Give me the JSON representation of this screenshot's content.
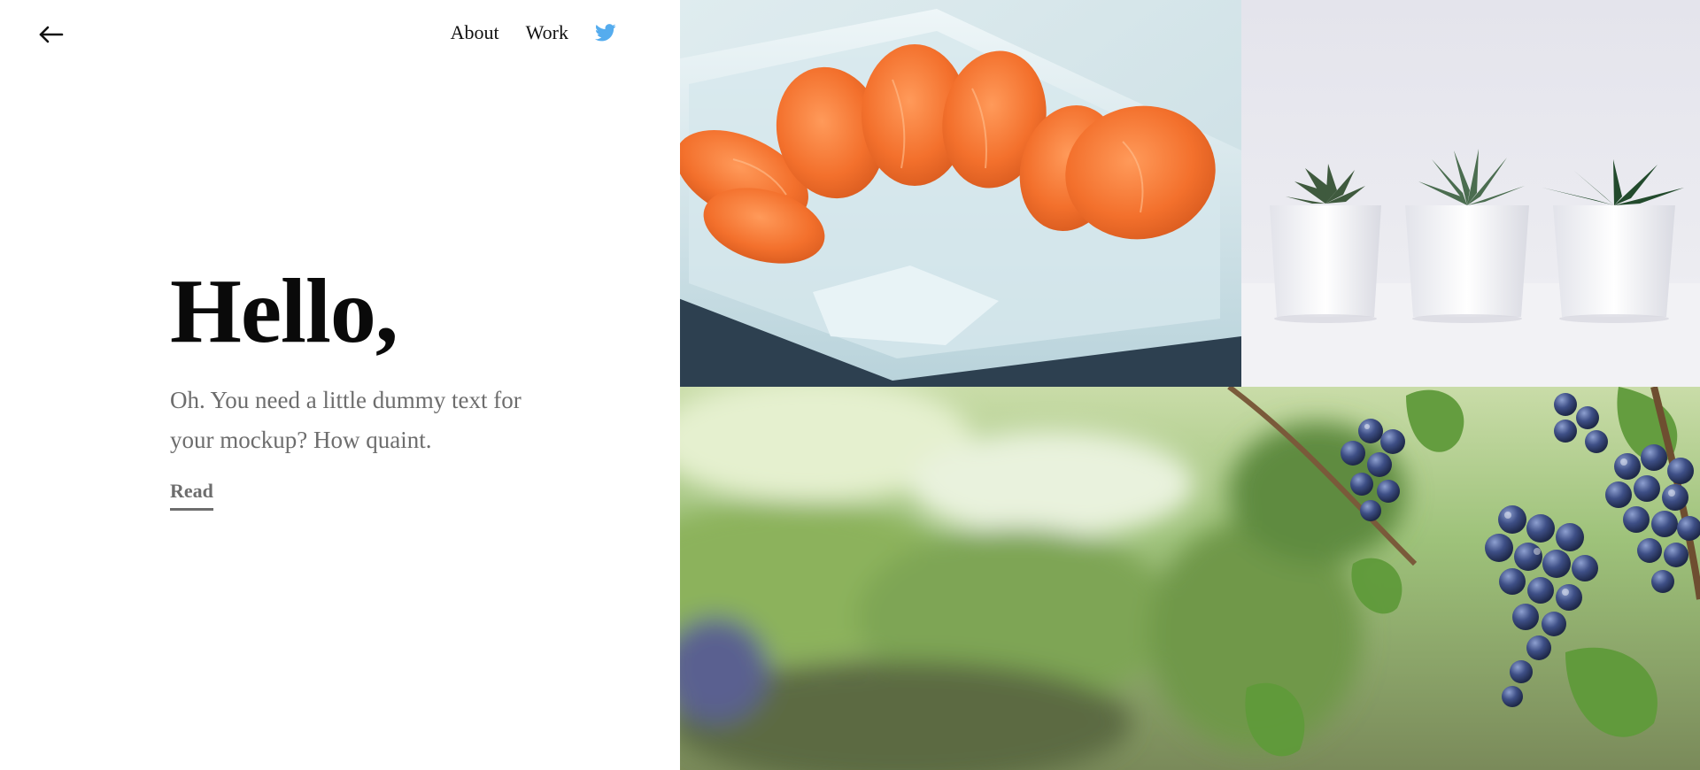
{
  "nav": {
    "back_icon": "arrow-left-icon",
    "links": [
      {
        "label": "About"
      },
      {
        "label": "Work"
      }
    ],
    "twitter_icon": "twitter-icon",
    "twitter_color": "#55acee"
  },
  "hero": {
    "title": "Hello,",
    "body": "Oh. You need a little dummy text for your mockup? How quaint.",
    "read_label": "Read"
  },
  "gallery": {
    "images": [
      {
        "name": "oranges-image",
        "alt": "Orange segments on a white square plate"
      },
      {
        "name": "succulents-image",
        "alt": "Three succulents in white pots"
      },
      {
        "name": "grapes-image",
        "alt": "Bunches of dark grapes in a vineyard"
      }
    ]
  },
  "colors": {
    "text_primary": "#0a0a0a",
    "text_muted": "#6d6d6d",
    "background": "#ffffff"
  }
}
